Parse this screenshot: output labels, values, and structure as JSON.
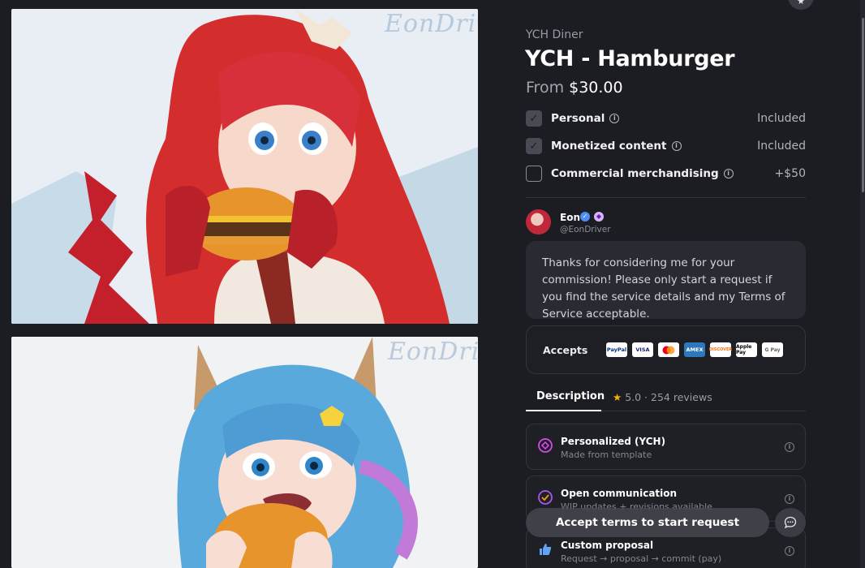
{
  "gallery": {
    "image1_watermark": "EonDriver",
    "image2_watermark": "EonDriver"
  },
  "header": {
    "shop_name": "YCH Diner",
    "title": "YCH - Hamburger",
    "price_from": "From",
    "price": "$30.00"
  },
  "usage": [
    {
      "label": "Personal",
      "value": "Included",
      "checked": true
    },
    {
      "label": "Monetized content",
      "value": "Included",
      "checked": true
    },
    {
      "label": "Commercial merchandising",
      "value": "+$50",
      "checked": false
    }
  ],
  "artist": {
    "name": "Eon",
    "handle": "@EonDriver",
    "message": "Thanks for considering me for your commission! Please only start a request if you find the service details and my Terms of Service acceptable."
  },
  "accepts": {
    "label": "Accepts",
    "methods": [
      "PayPal",
      "VISA",
      "Mastercard",
      "AMEX",
      "DISCOVER",
      "Apple Pay",
      "G Pay"
    ]
  },
  "tabs": {
    "description": "Description",
    "rating": "5.0",
    "reviews": "· 254 reviews"
  },
  "features": [
    {
      "title": "Personalized (YCH)",
      "subtitle": "Made from template",
      "icon": "personalized-icon"
    },
    {
      "title": "Open communication",
      "subtitle": "WIP updates + revisions available",
      "icon": "communication-icon"
    },
    {
      "title": "Custom proposal",
      "subtitle": "Request → proposal → commit (pay)",
      "icon": "proposal-icon"
    }
  ],
  "cta": {
    "label": "Accept terms to start request"
  },
  "colors": {
    "background": "#1c1c23",
    "card": "#2a2a33",
    "accent_purple": "#8b5cf6",
    "star": "#f5b400"
  }
}
